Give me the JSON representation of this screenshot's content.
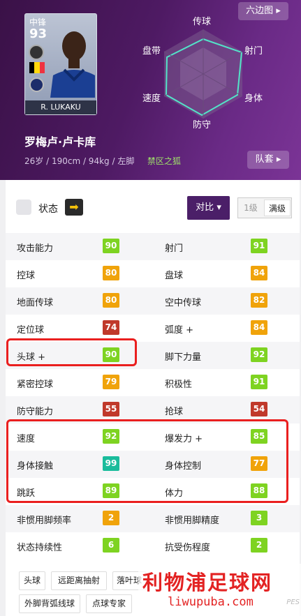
{
  "header": {
    "hex_button": "六边图",
    "player_name": "罗梅卢·卢卡库",
    "info": "26岁 / 190cm / 94kg / 左脚",
    "nickname": "禁区之狐",
    "team_button": "队套"
  },
  "card": {
    "position": "中锋",
    "overall": "93",
    "name": "R. LUKAKU",
    "flag_colors": [
      "#000000",
      "#ffd90c",
      "#ef3340"
    ]
  },
  "radar": {
    "labels": [
      "传球",
      "射门",
      "身体",
      "防守",
      "速度",
      "盘带"
    ]
  },
  "status_bar": {
    "label": "状态",
    "arrow": "➡",
    "compare": "对比",
    "level_1": "1级",
    "level_max": "满级"
  },
  "stats": [
    {
      "l": "攻击能力",
      "lv": "90",
      "lc": "#7ed321",
      "r": "射门",
      "rv": "91",
      "rc": "#7ed321"
    },
    {
      "l": "控球",
      "lv": "80",
      "lc": "#f0a30a",
      "r": "盘球",
      "rv": "84",
      "rc": "#f0a30a"
    },
    {
      "l": "地面传球",
      "lv": "80",
      "lc": "#f0a30a",
      "r": "空中传球",
      "rv": "82",
      "rc": "#f0a30a"
    },
    {
      "l": "定位球",
      "lv": "74",
      "lc": "#c0392b",
      "r": "弧度 +",
      "rv": "84",
      "rc": "#f0a30a"
    },
    {
      "l": "头球 +",
      "lv": "90",
      "lc": "#7ed321",
      "r": "脚下力量",
      "rv": "92",
      "rc": "#7ed321"
    },
    {
      "l": "紧密控球",
      "lv": "79",
      "lc": "#f0a30a",
      "r": "积极性",
      "rv": "91",
      "rc": "#7ed321"
    },
    {
      "l": "防守能力",
      "lv": "55",
      "lc": "#c0392b",
      "r": "抢球",
      "rv": "54",
      "rc": "#c0392b"
    },
    {
      "l": "速度",
      "lv": "92",
      "lc": "#7ed321",
      "r": "爆发力 +",
      "rv": "85",
      "rc": "#7ed321"
    },
    {
      "l": "身体接触",
      "lv": "99",
      "lc": "#1abc9c",
      "r": "身体控制",
      "rv": "77",
      "rc": "#f0a30a"
    },
    {
      "l": "跳跃",
      "lv": "89",
      "lc": "#7ed321",
      "r": "体力",
      "rv": "88",
      "rc": "#7ed321"
    },
    {
      "l": "非惯用脚频率",
      "lv": "2",
      "lc": "#f0a30a",
      "r": "非惯用脚精度",
      "rv": "3",
      "rc": "#7ed321"
    },
    {
      "l": "状态持续性",
      "lv": "6",
      "lc": "#7ed321",
      "r": "抗受伤程度",
      "rv": "2",
      "rc": "#7ed321"
    }
  ],
  "skills": [
    "头球",
    "远距离抽射",
    "落叶球",
    "外脚背弧线球",
    "点球专家"
  ],
  "watermark": {
    "title": "利物浦足球网",
    "url": "liwupuba.com",
    "corner": "PES"
  }
}
